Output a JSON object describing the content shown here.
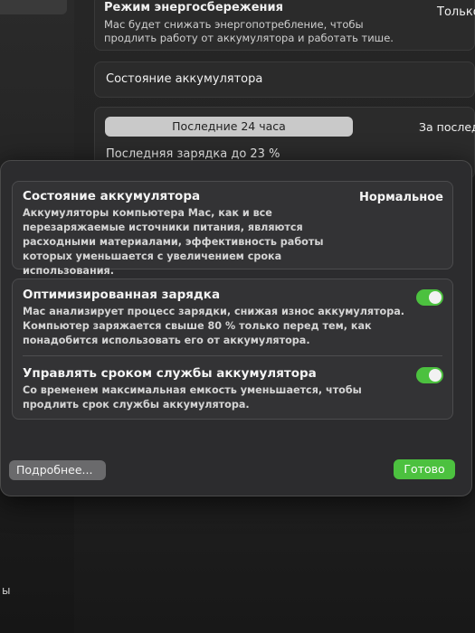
{
  "background": {
    "sidebar_fragment": "ы",
    "energy_mode": {
      "title": "Режим энергосбережения",
      "description": "Mac будет снижать энергопотребление, чтобы продлить работу от аккумулятора и работать тише.",
      "value": "Только"
    },
    "battery_health_title": "Состояние аккумулятора",
    "segments": [
      "Последние 24 часа",
      "За послед"
    ],
    "last_charge": "Последняя зарядка до 23 %"
  },
  "sheet": {
    "battery_status": {
      "title": "Состояние аккумулятора",
      "value": "Нормальное",
      "description": "Аккумуляторы компьютера Mac, как и все перезаряжаемые источники питания, являются расходными материалами, эффективность работы которых уменьшается с увеличением срока использования."
    },
    "optimized_charging": {
      "title": "Оптимизированная зарядка",
      "description": "Mac анализирует процесс зарядки, снижая износ аккумулятора. Компьютер заряжается свыше 80 % только перед тем, как понадобится использовать его от аккумулятора.",
      "enabled": true
    },
    "manage_lifespan": {
      "title": "Управлять сроком службы аккумулятора",
      "description": "Со временем максимальная емкость уменьшается, чтобы продлить срок службы аккумулятора.",
      "enabled": true
    },
    "more_button": "Подробнее...",
    "done_button": "Готово"
  },
  "colors": {
    "accent_green": "#4cc13f",
    "sheet_bg": "#2c2c2e"
  }
}
